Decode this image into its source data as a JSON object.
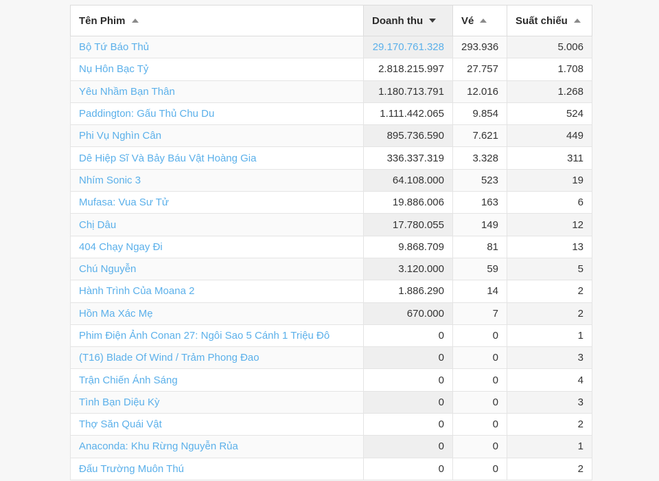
{
  "table": {
    "columns": [
      {
        "key": "name",
        "label": "Tên Phim",
        "align": "left",
        "sort": "asc",
        "active": false
      },
      {
        "key": "rev",
        "label": "Doanh thu",
        "align": "right",
        "sort": "desc",
        "active": true
      },
      {
        "key": "ticket",
        "label": "Vé",
        "align": "right",
        "sort": "asc",
        "active": false
      },
      {
        "key": "shows",
        "label": "Suất chiếu",
        "align": "right",
        "sort": "asc",
        "active": false
      }
    ],
    "rows": [
      {
        "name": "Bộ Tứ Báo Thủ",
        "rev": "29.170.761.328",
        "ticket": "293.936",
        "shows": "5.006",
        "rev_highlight": true
      },
      {
        "name": "Nụ Hôn Bạc Tỷ",
        "rev": "2.818.215.997",
        "ticket": "27.757",
        "shows": "1.708",
        "rev_highlight": false
      },
      {
        "name": "Yêu Nhầm Bạn Thân",
        "rev": "1.180.713.791",
        "ticket": "12.016",
        "shows": "1.268",
        "rev_highlight": false
      },
      {
        "name": "Paddington: Gấu Thủ Chu Du",
        "rev": "1.111.442.065",
        "ticket": "9.854",
        "shows": "524",
        "rev_highlight": false
      },
      {
        "name": "Phi Vụ Nghìn Cân",
        "rev": "895.736.590",
        "ticket": "7.621",
        "shows": "449",
        "rev_highlight": false
      },
      {
        "name": "Dê Hiệp Sĩ Và Bảy Báu Vật Hoàng Gia",
        "rev": "336.337.319",
        "ticket": "3.328",
        "shows": "311",
        "rev_highlight": false
      },
      {
        "name": "Nhím Sonic 3",
        "rev": "64.108.000",
        "ticket": "523",
        "shows": "19",
        "rev_highlight": false
      },
      {
        "name": "Mufasa: Vua Sư Tử",
        "rev": "19.886.006",
        "ticket": "163",
        "shows": "6",
        "rev_highlight": false
      },
      {
        "name": "Chị Dâu",
        "rev": "17.780.055",
        "ticket": "149",
        "shows": "12",
        "rev_highlight": false
      },
      {
        "name": "404 Chạy Ngay Đi",
        "rev": "9.868.709",
        "ticket": "81",
        "shows": "13",
        "rev_highlight": false
      },
      {
        "name": "Chú Nguyễn",
        "rev": "3.120.000",
        "ticket": "59",
        "shows": "5",
        "rev_highlight": false
      },
      {
        "name": "Hành Trình Của Moana 2",
        "rev": "1.886.290",
        "ticket": "14",
        "shows": "2",
        "rev_highlight": false
      },
      {
        "name": "Hồn Ma Xác Mẹ",
        "rev": "670.000",
        "ticket": "7",
        "shows": "2",
        "rev_highlight": false
      },
      {
        "name": "Phim Điện Ảnh Conan 27: Ngôi Sao 5 Cánh 1 Triệu Đô",
        "rev": "0",
        "ticket": "0",
        "shows": "1",
        "rev_highlight": false
      },
      {
        "name": "(T16) Blade Of Wind / Trảm Phong Đao",
        "rev": "0",
        "ticket": "0",
        "shows": "3",
        "rev_highlight": false
      },
      {
        "name": "Trận Chiến Ánh Sáng",
        "rev": "0",
        "ticket": "0",
        "shows": "4",
        "rev_highlight": false
      },
      {
        "name": "Tình Bạn Diệu Kỳ",
        "rev": "0",
        "ticket": "0",
        "shows": "3",
        "rev_highlight": false
      },
      {
        "name": "Thợ Săn Quái Vật",
        "rev": "0",
        "ticket": "0",
        "shows": "2",
        "rev_highlight": false
      },
      {
        "name": "Anaconda: Khu Rừng Nguyễn Rủa",
        "rev": "0",
        "ticket": "0",
        "shows": "1",
        "rev_highlight": false
      },
      {
        "name": "Đấu Trường Muôn Thú",
        "rev": "0",
        "ticket": "0",
        "shows": "2",
        "rev_highlight": false
      }
    ]
  },
  "colors": {
    "link": "#5bb0ea",
    "page_background": "#f7f7f7",
    "row_stripe": "#fafafa",
    "sorted_column": "#efefef",
    "border": "#e4e4e4",
    "text": "#333333"
  }
}
